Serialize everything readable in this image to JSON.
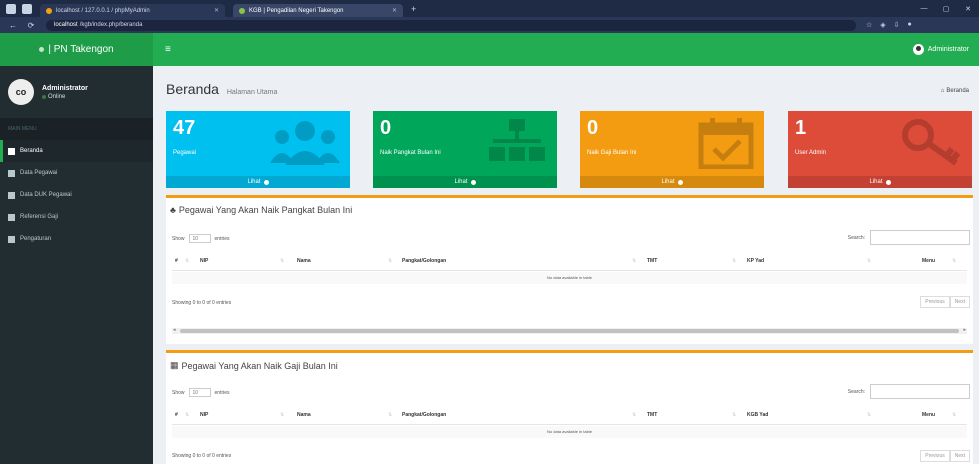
{
  "browser": {
    "tabs": [
      {
        "label": "localhost / 127.0.0.1 / phpMyAdmin"
      },
      {
        "label": "KGB | Pengadilan Negeri Takengon"
      }
    ],
    "new_tab": "+",
    "url_host": "localhost",
    "url_path": "/kgb/index.php/beranda",
    "nav": {
      "back": "←",
      "reload": "⟳"
    }
  },
  "app": {
    "logo_text": "| PN Takengon",
    "toggle": "≡",
    "user_menu_label": "Administrator"
  },
  "sidebar": {
    "user_name": "Administrator",
    "user_status": "Online",
    "avatar_text": "co",
    "menu_header": "MAIN MENU",
    "items": [
      {
        "label": "Beranda",
        "active": true
      },
      {
        "label": "Data Pegawai",
        "active": false
      },
      {
        "label": "Data DUK Pegawai",
        "active": false
      },
      {
        "label": "Referensi Gaji",
        "active": false
      },
      {
        "label": "Pengaturan",
        "active": false
      }
    ]
  },
  "page": {
    "title": "Beranda",
    "subtitle": "Halaman Utama",
    "breadcrumb": "Beranda"
  },
  "stat_boxes": [
    {
      "value": "47",
      "label": "Pegawai",
      "footer": "Lihat",
      "color": "#00c0ef",
      "icon": "users-icon"
    },
    {
      "value": "0",
      "label": "Naik Pangkat Bulan Ini",
      "footer": "Lihat",
      "color": "#00a65a",
      "icon": "sitemap-icon"
    },
    {
      "value": "0",
      "label": "Naik Gaji Bulan Ini",
      "footer": "Lihat",
      "color": "#f39c12",
      "icon": "calendar-check-icon"
    },
    {
      "value": "1",
      "label": "User Admin",
      "footer": "Lihat",
      "color": "#dd4b39",
      "icon": "key-icon"
    }
  ],
  "panels": [
    {
      "title": "Pegawai Yang Akan Naik Pangkat Bulan Ini",
      "show_label": "Show",
      "show_value": "10",
      "entries_label": "entries",
      "search_label": "Search:",
      "columns": [
        "#",
        "NIP",
        "Nama",
        "Pangkat/Golongan",
        "TMT",
        "KP Yad",
        "Menu"
      ],
      "empty_text": "No data available in table",
      "info": "Showing 0 to 0 of 0 entries",
      "prev": "Previous",
      "next": "Next"
    },
    {
      "title": "Pegawai Yang Akan Naik Gaji Bulan Ini",
      "show_label": "Show",
      "show_value": "10",
      "entries_label": "entries",
      "search_label": "Search:",
      "columns": [
        "#",
        "NIP",
        "Nama",
        "Pangkat/Golongan",
        "TMT",
        "KGB Yad",
        "Menu"
      ],
      "empty_text": "No data available in table",
      "info": "Showing 0 to 0 of 0 entries",
      "prev": "Previous",
      "next": "Next"
    }
  ]
}
